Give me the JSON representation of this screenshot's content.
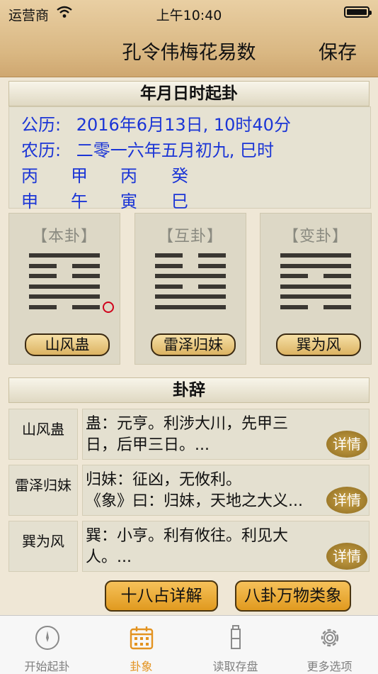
{
  "status": {
    "carrier": "运营商",
    "time": "上午10:40"
  },
  "nav": {
    "title": "孔令伟梅花易数",
    "save": "保存"
  },
  "header_date": {
    "title": "年月日时起卦",
    "solar_label": "公历:",
    "solar_value": "2016年6月13日, 10时40分",
    "lunar_label": "农历:",
    "lunar_value": "二零一六年五月初九, 巳时",
    "stems": [
      "丙",
      "甲",
      "丙",
      "癸"
    ],
    "branches": [
      "申",
      "午",
      "寅",
      "巳"
    ]
  },
  "hexagrams": [
    {
      "label": "【本卦】",
      "name": "山风蛊",
      "lines": [
        1,
        0,
        0,
        1,
        1,
        0
      ],
      "moving_line": 5
    },
    {
      "label": "【互卦】",
      "name": "雷泽归妹",
      "lines": [
        0,
        0,
        1,
        0,
        1,
        1
      ],
      "moving_line": null
    },
    {
      "label": "【变卦】",
      "name": "巽为风",
      "lines": [
        1,
        1,
        0,
        1,
        1,
        0
      ],
      "moving_line": null
    }
  ],
  "guaci": {
    "title": "卦辞",
    "detail_label": "详情",
    "rows": [
      {
        "name": "山风蛊",
        "line1": "蛊：元亨。利涉大川，先甲三",
        "line2": "日，后甲三日。..."
      },
      {
        "name": "雷泽归妹",
        "line1": "归妹：征凶，无攸利。",
        "line2": "《象》曰：归妹，天地之大义..."
      },
      {
        "name": "巽为风",
        "line1": "巽：小亨。利有攸往。利见大",
        "line2": "人。..."
      }
    ]
  },
  "buttons": {
    "eighteen": "十八占详解",
    "bagua": "八卦万物类象"
  },
  "tabs": [
    {
      "label": "开始起卦",
      "icon": "compass-icon"
    },
    {
      "label": "卦象",
      "icon": "calendar-icon"
    },
    {
      "label": "读取存盘",
      "icon": "bottle-icon"
    },
    {
      "label": "更多选项",
      "icon": "gear-icon"
    }
  ],
  "colors": {
    "accent": "#e39320",
    "blue_text": "#1b35d6",
    "moving_mark": "#d0021b"
  }
}
